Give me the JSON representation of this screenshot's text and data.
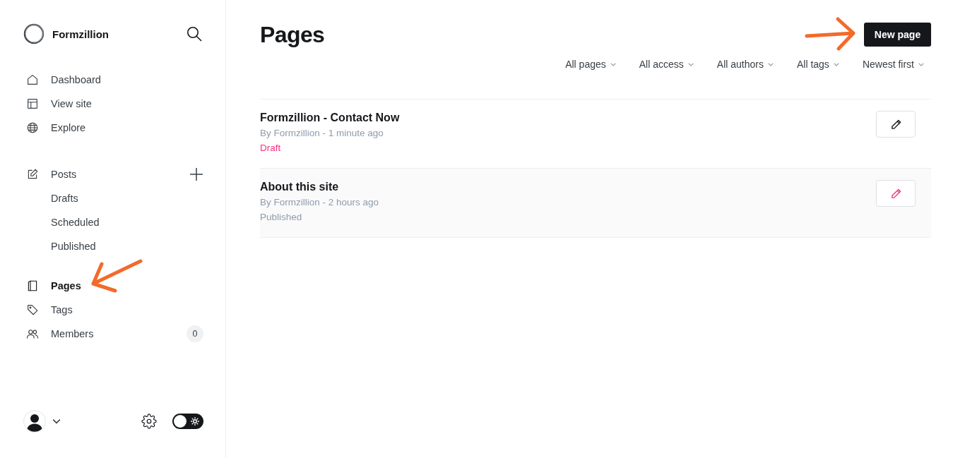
{
  "sidebar": {
    "brand": {
      "name": "Formzillion"
    },
    "nav_sections": [
      {
        "items": [
          {
            "label": "Dashboard",
            "selected": false,
            "callout": false
          },
          {
            "label": "View site",
            "selected": false,
            "callout": false
          },
          {
            "label": "Explore",
            "selected": false,
            "callout": false
          }
        ]
      },
      {
        "items": [
          {
            "label": "Posts",
            "selected": false,
            "callout": false,
            "add_button": true,
            "children": [
              {
                "label": "Drafts",
                "selected": false
              },
              {
                "label": "Scheduled",
                "selected": false
              },
              {
                "label": "Published",
                "selected": false
              }
            ]
          }
        ]
      },
      {
        "items": [
          {
            "label": "Pages",
            "selected": true,
            "callout": true
          },
          {
            "label": "Tags",
            "selected": false,
            "callout": false
          },
          {
            "label": "Members",
            "selected": false,
            "callout": false,
            "count": "0"
          }
        ]
      }
    ],
    "footer": {
      "theme_toggle": {
        "on": false
      }
    }
  },
  "main": {
    "title": "Pages",
    "new_button": {
      "label": "New page",
      "callout": true
    },
    "filters": [
      {
        "label": "All pages"
      },
      {
        "label": "All access"
      },
      {
        "label": "All authors"
      },
      {
        "label": "All tags"
      },
      {
        "label": "Newest first"
      }
    ],
    "pages": [
      {
        "title": "Formzillion - Contact Now",
        "meta": "By Formzillion - 1 minute ago",
        "status": {
          "text": "Draft",
          "kind": "draft"
        },
        "hovered": false
      },
      {
        "title": "About this site",
        "meta": "By Formzillion - 2 hours ago",
        "status": {
          "text": "Published",
          "kind": "published"
        },
        "hovered": true
      }
    ]
  }
}
